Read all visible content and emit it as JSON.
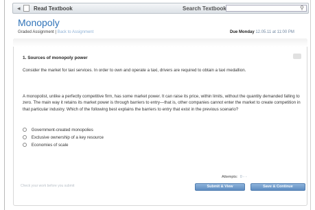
{
  "toolbar": {
    "nav_arrow": "◂",
    "read_textbook": "Read Textbook",
    "search_label": "Search Textbook",
    "search_value": "",
    "search_icon": "🔍"
  },
  "header": {
    "title": "Monopoly",
    "graded": "Graded Assignment |",
    "link": "Back to Assignment",
    "due_label": "Due Monday",
    "due_date": "12.05.11 at 11:00 PM"
  },
  "question": {
    "title": "1. Sources of monopoly power",
    "paragraph1": "Consider the market for taxi services. In order to own and operate a taxi, drivers are required to obtain a taxi medallion.",
    "paragraph2": "A monopolist, unlike a perfectly competitive firm, has some market power. It can raise its price, within limits, without the quantity demanded falling to zero. The main way it retains its market power is through barriers to entry—that is, other companies cannot enter the market to create competition in that particular industry. Which of the following best explains the barriers to entry that exist in the previous scenario?",
    "options": [
      "Government-created monopolies",
      "Exclusive ownership of a key resource",
      "Economies of scale"
    ]
  },
  "footer": {
    "attempts_label": "Attempts:",
    "attempts_dots": "0 - -",
    "note": "Check your work before you submit",
    "submit_label": "Submit & View",
    "save_label": "Save & Continue"
  }
}
